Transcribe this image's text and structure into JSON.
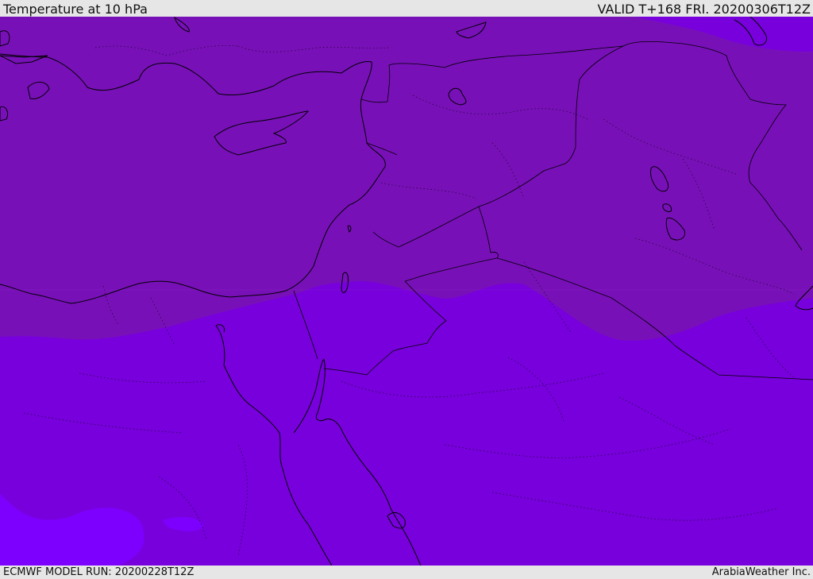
{
  "header": {
    "title": "Temperature at 10 hPa",
    "valid": "VALID T+168 FRI. 20200306T12Z"
  },
  "footer": {
    "model_run": "ECMWF MODEL RUN: 20200228T12Z",
    "provider": "ArabiaWeather Inc."
  },
  "colors": {
    "band_dark": "#7810b8",
    "band_mid": "#7800dc",
    "band_bright": "#7d00ff",
    "coastline": "#000000",
    "chrome": "#e6e6e6"
  }
}
